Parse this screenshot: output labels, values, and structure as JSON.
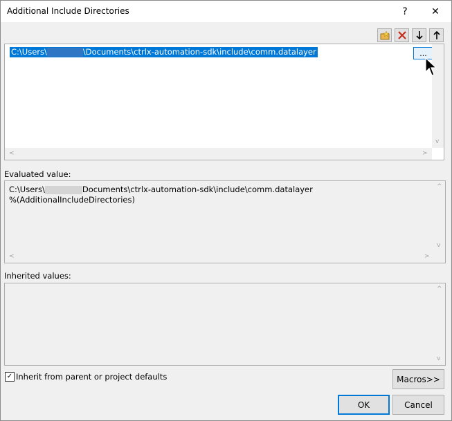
{
  "window": {
    "title": "Additional Include Directories",
    "help_label": "?",
    "close_label": "✕"
  },
  "toolbar": {
    "new_line_icon": "folder-new-icon",
    "delete_icon": "delete-x-icon",
    "move_down_label": "🡣",
    "move_up_label": "🡡"
  },
  "directories": {
    "entries": [
      {
        "prefix": "C:\\Users\\",
        "suffix": "\\Documents\\ctrlx-automation-sdk\\include\\comm.datalayer"
      }
    ],
    "browse_label": "..."
  },
  "evaluated": {
    "label": "Evaluated value:",
    "lines": [
      {
        "prefix": "C:\\Users\\",
        "suffix": "Documents\\ctrlx-automation-sdk\\include\\comm.datalayer"
      },
      {
        "text": "%(AdditionalIncludeDirectories)"
      }
    ]
  },
  "inherited": {
    "label": "Inherited values:"
  },
  "inherit_checkbox": {
    "label": "Inherit from parent or project defaults",
    "checked": true,
    "mark": "✓"
  },
  "buttons": {
    "macros": "Macros>>",
    "ok": "OK",
    "cancel": "Cancel"
  },
  "scroll": {
    "left": "<",
    "right": ">",
    "up": "^",
    "down": "v"
  },
  "colors": {
    "selection": "#0078d7",
    "button_face": "#e1e1e1",
    "dialog_bg": "#f0f0f0"
  }
}
